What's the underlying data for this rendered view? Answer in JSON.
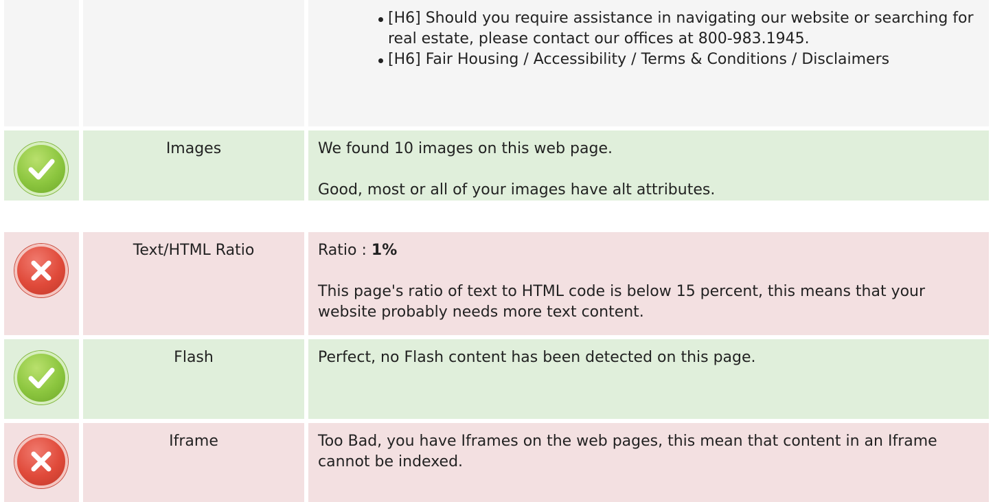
{
  "headings_row": {
    "items": [
      "[H6] Should you require assistance in navigating our website or searching for real estate, please contact our offices at 800-983.1945.",
      "[H6] Fair Housing / Accessibility / Terms & Conditions / Disclaimers"
    ]
  },
  "rows": [
    {
      "status": "pass",
      "icon": "check-icon",
      "label": "Images",
      "lines": [
        "We found 10 images on this web page.",
        "Good, most or all of your images have alt attributes."
      ]
    },
    {
      "status": "fail",
      "icon": "cross-icon",
      "label": "Text/HTML Ratio",
      "ratio_prefix": "Ratio : ",
      "ratio_value": "1%",
      "lines": [
        "This page's ratio of text to HTML code is below 15 percent, this means that your website probably needs more text content."
      ]
    },
    {
      "status": "pass",
      "icon": "check-icon",
      "label": "Flash",
      "lines": [
        "Perfect, no Flash content has been detected on this page."
      ]
    },
    {
      "status": "fail",
      "icon": "cross-icon",
      "label": "Iframe",
      "lines": [
        "Too Bad, you have Iframes on the web pages, this mean that content in an Iframe cannot be indexed."
      ]
    }
  ],
  "colors": {
    "pass_bg": "#e0efdb",
    "fail_bg": "#f3e0e1",
    "neutral_bg": "#f5f5f5",
    "pass_icon": "#8cc63f",
    "fail_icon": "#e04a3a"
  }
}
